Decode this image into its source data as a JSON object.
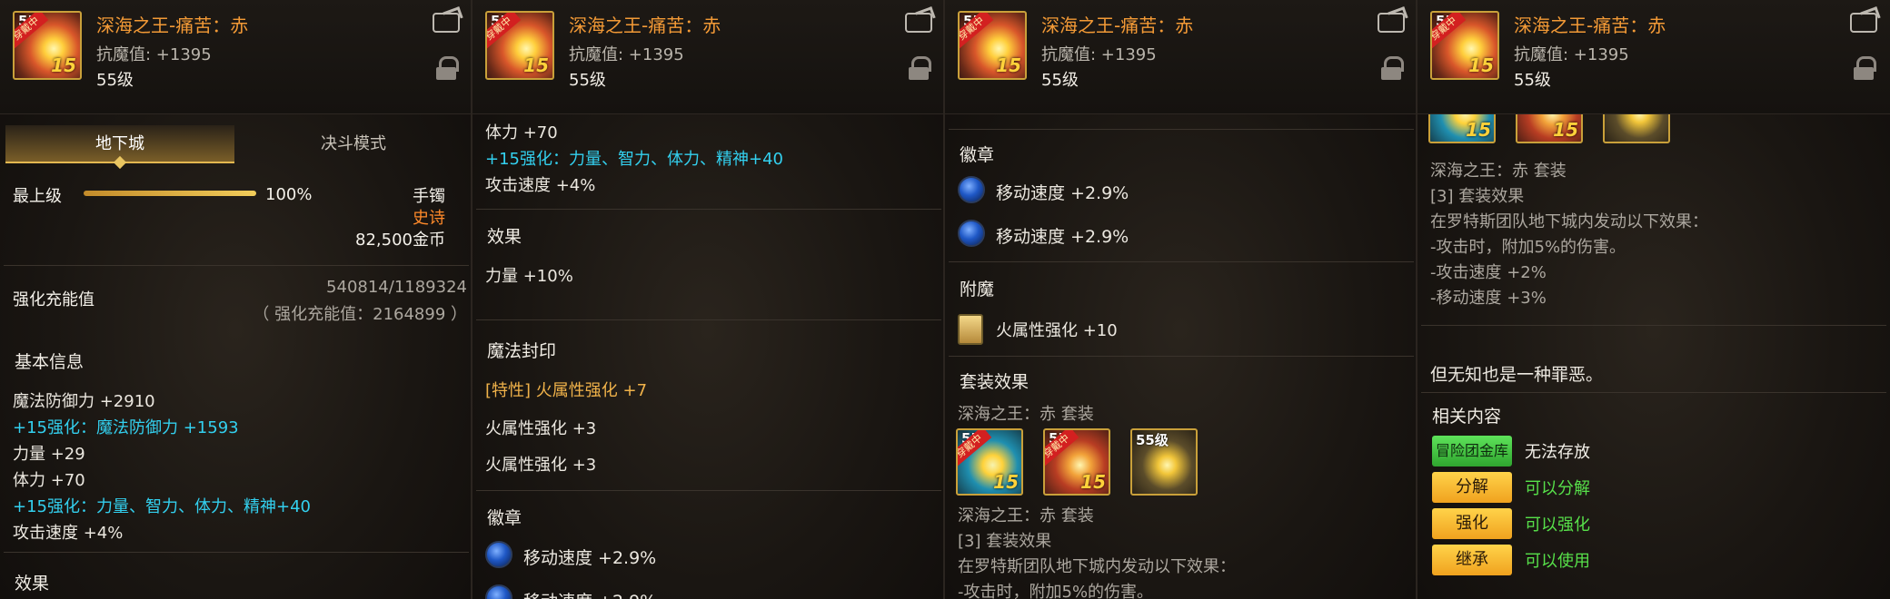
{
  "item": {
    "name": "深海之王-痛苦：赤",
    "sub_stat": "抗魔值: +1395",
    "level": "55级",
    "icon_level": "55",
    "icon_badge": "穿戴中",
    "icon_plus": "15"
  },
  "panel1": {
    "tab_dungeon": "地下城",
    "tab_duel": "决斗模式",
    "grade_label": "最上级",
    "grade_percent": "100%",
    "grade_fill": 1.0,
    "slot": "手镯",
    "rarity": "史诗",
    "price": "82,500金币",
    "charge_label": "强化充能值",
    "charge_value": "540814/1189324",
    "charge_total": "（ 强化充能值：2164899 ）",
    "basic_info": "基本信息",
    "stat1": "魔法防御力 +2910",
    "stat2": "+15强化：魔法防御力 +1593",
    "stat3": "力量 +29",
    "stat4": "体力 +70",
    "stat5": "+15强化：力量、智力、体力、精神+40",
    "stat6": "攻击速度 +4%",
    "effect_title": "效果"
  },
  "panel2": {
    "stat_vit": "体力 +70",
    "stat_enh": "+15强化：力量、智力、体力、精神+40",
    "stat_aspd": "攻击速度 +4%",
    "effect_title": "效果",
    "effect_value": "力量 +10%",
    "seal_title": "魔法封印",
    "seal1": "[特性] 火属性强化 +7",
    "seal2": "火属性强化 +3",
    "seal3": "火属性强化 +3",
    "emblem_title": "徽章",
    "emblem1": "移动速度 +2.9%",
    "emblem2": "移动速度 +2.9%"
  },
  "panel3": {
    "emblem_title": "徽章",
    "emblem1": "移动速度 +2.9%",
    "emblem2": "移动速度 +2.9%",
    "enchant_title": "附魔",
    "enchant1": "火属性强化 +10",
    "set_title": "套装效果",
    "set_name": "深海之王：赤 套装",
    "set_item_level": "55级",
    "set_name2": "深海之王：赤 套装",
    "set_count": "[3] 套装效果",
    "set_desc": "在罗特斯团队地下城内发动以下效果：",
    "set_line1": "-攻击时，附加5%的伤害。"
  },
  "panel4": {
    "set_name": "深海之王：赤 套装",
    "set_count": "[3] 套装效果",
    "set_desc": "在罗特斯团队地下城内发动以下效果：",
    "set_line1": "-攻击时，附加5%的伤害。",
    "set_line2": "-攻击速度 +2%",
    "set_line3": "-移动速度 +3%",
    "flavor": "但无知也是一种罪恶。",
    "related_title": "相关内容",
    "rel1_btn": "冒险团金库",
    "rel1_text": "无法存放",
    "rel2_btn": "分解",
    "rel2_text": "可以分解",
    "rel3_btn": "强化",
    "rel3_text": "可以强化",
    "rel4_btn": "继承",
    "rel4_text": "可以使用"
  }
}
